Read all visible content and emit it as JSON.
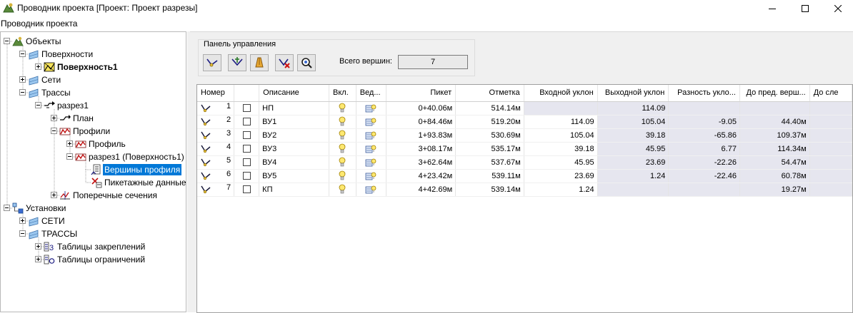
{
  "window": {
    "title": "Проводник проекта [Проект: Проект разрезы]",
    "panel_caption": "Проводник проекта"
  },
  "tree": [
    {
      "label": "Объекты",
      "icon": "objects-icon",
      "toggle": "minus",
      "level": 0
    },
    {
      "label": "Поверхности",
      "icon": "surfaces-folder-icon",
      "toggle": "minus",
      "level": 1
    },
    {
      "label": "Поверхность1",
      "icon": "surface-icon",
      "toggle": "plus",
      "level": 2,
      "bold": true
    },
    {
      "label": "Сети",
      "icon": "networks-folder-icon",
      "toggle": "plus",
      "level": 1
    },
    {
      "label": "Трассы",
      "icon": "alignments-folder-icon",
      "toggle": "minus",
      "level": 1
    },
    {
      "label": "разрез1",
      "icon": "alignment-icon",
      "toggle": "minus",
      "level": 2
    },
    {
      "label": "План",
      "icon": "plan-icon",
      "toggle": "plus",
      "level": 3
    },
    {
      "label": "Профили",
      "icon": "profiles-icon",
      "toggle": "minus",
      "level": 3
    },
    {
      "label": "Профиль",
      "icon": "profile-icon",
      "toggle": "plus",
      "level": 4
    },
    {
      "label": "разрез1 (Поверхность1)",
      "icon": "profile-icon",
      "toggle": "minus",
      "level": 4
    },
    {
      "label": "Вершины профиля",
      "icon": "profile-vertices-icon",
      "toggle": null,
      "level": 5,
      "selected": true
    },
    {
      "label": "Пикетажные данные",
      "icon": "station-data-icon",
      "toggle": null,
      "level": 5
    },
    {
      "label": "Поперечные сечения",
      "icon": "cross-sections-icon",
      "toggle": "plus",
      "level": 3
    },
    {
      "label": "Установки",
      "icon": "settings-icon",
      "toggle": "minus",
      "level": 0
    },
    {
      "label": "СЕТИ",
      "icon": "networks-settings-icon",
      "toggle": "plus",
      "level": 1
    },
    {
      "label": "ТРАССЫ",
      "icon": "alignments-settings-icon",
      "toggle": "minus",
      "level": 1
    },
    {
      "label": "Таблицы закреплений",
      "icon": "fixation-tables-icon",
      "toggle": "plus",
      "level": 2
    },
    {
      "label": "Таблицы ограничений",
      "icon": "constraint-tables-icon",
      "toggle": "plus",
      "level": 2
    }
  ],
  "control_panel": {
    "title": "Панель управления",
    "buttons": [
      {
        "name": "add-vertex-button",
        "icon": "add-vertex-icon"
      },
      {
        "name": "insert-vertex-button",
        "icon": "insert-vertex-icon"
      },
      {
        "name": "edit-vertex-button",
        "icon": "pencil-icon"
      },
      {
        "name": "delete-vertex-button",
        "icon": "delete-vertex-icon"
      },
      {
        "name": "zoom-to-vertex-button",
        "icon": "zoom-icon"
      }
    ],
    "count_label": "Всего вершин:",
    "count_value": "7"
  },
  "table": {
    "columns": [
      "Номер",
      "",
      "Описание",
      "Вкл.",
      "Вед...",
      "Пикет",
      "Отметка",
      "Входной уклон",
      "Выходной уклон",
      "Разность укло...",
      "До пред. верш...",
      "До сле"
    ],
    "rows": [
      {
        "num": "1",
        "desc": "НП",
        "station": "0+40.06м",
        "elev": "514.14м",
        "in_slope": "",
        "out_slope": "114.09",
        "diff": "",
        "to_prev": "",
        "to_next": ""
      },
      {
        "num": "2",
        "desc": "ВУ1",
        "station": "0+84.46м",
        "elev": "519.20м",
        "in_slope": "114.09",
        "out_slope": "105.04",
        "diff": "-9.05",
        "to_prev": "44.40м",
        "to_next": ""
      },
      {
        "num": "3",
        "desc": "ВУ2",
        "station": "1+93.83м",
        "elev": "530.69м",
        "in_slope": "105.04",
        "out_slope": "39.18",
        "diff": "-65.86",
        "to_prev": "109.37м",
        "to_next": ""
      },
      {
        "num": "4",
        "desc": "ВУ3",
        "station": "3+08.17м",
        "elev": "535.17м",
        "in_slope": "39.18",
        "out_slope": "45.95",
        "diff": "6.77",
        "to_prev": "114.34м",
        "to_next": ""
      },
      {
        "num": "5",
        "desc": "ВУ4",
        "station": "3+62.64м",
        "elev": "537.67м",
        "in_slope": "45.95",
        "out_slope": "23.69",
        "diff": "-22.26",
        "to_prev": "54.47м",
        "to_next": ""
      },
      {
        "num": "6",
        "desc": "ВУ5",
        "station": "4+23.42м",
        "elev": "539.11м",
        "in_slope": "23.69",
        "out_slope": "1.24",
        "diff": "-22.46",
        "to_prev": "60.78м",
        "to_next": ""
      },
      {
        "num": "7",
        "desc": "КП",
        "station": "4+42.69м",
        "elev": "539.14м",
        "in_slope": "1.24",
        "out_slope": "",
        "diff": "",
        "to_prev": "19.27м",
        "to_next": ""
      }
    ]
  },
  "colors": {
    "selection": "#0078d7",
    "readonly_cell": "#e6e6ef",
    "panel_bg": "#f0f0f0"
  }
}
